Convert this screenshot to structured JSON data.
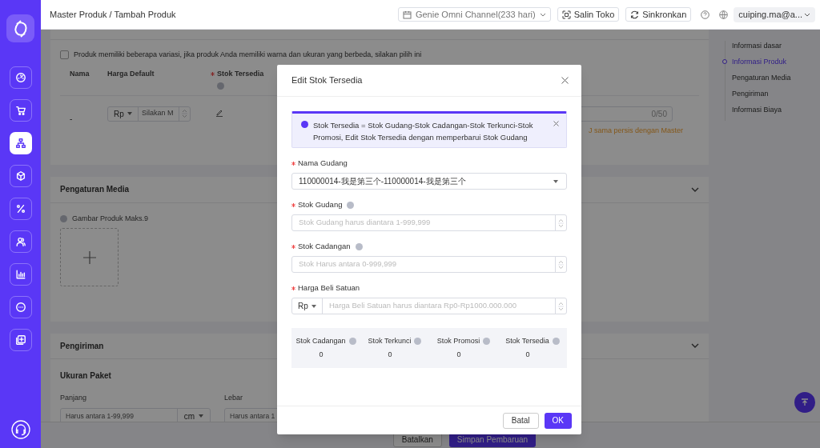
{
  "sidebar": {
    "items": [
      {
        "selected": false
      },
      {
        "selected": false
      },
      {
        "selected": true
      },
      {
        "selected": false
      },
      {
        "selected": false
      },
      {
        "selected": false
      },
      {
        "selected": false
      },
      {
        "selected": false
      },
      {
        "selected": false
      }
    ]
  },
  "header": {
    "breadcrumb": "Master Produk / Tambah Produk",
    "store_select": "Genie Omni Channel(233 hari)",
    "buttons": [
      "Salin Toko",
      "Sinkronkan"
    ],
    "user": "cuiping.ma@a..."
  },
  "variants": {
    "checkbox": {
      "label": "Produk memiliki beberapa variasi, jika produk Anda memiliki warna dan ukuran yang berbeda, silakan pilih ini",
      "checked": false
    },
    "columns": [
      {
        "label": "Nama",
        "required": false,
        "info": false
      },
      {
        "label": "Harga Default",
        "required": false,
        "info": false
      },
      {
        "label": "Stok Tersedia",
        "required": true,
        "info": true
      }
    ],
    "row": {
      "name": "-",
      "currency": "Rp",
      "price_placeholder": "Silakan M",
      "counter": "0/50",
      "warning": "J sama persis dengan Master"
    }
  },
  "media": {
    "title": "Pengaturan Media",
    "note": "Gambar Produk Maks.9"
  },
  "shipping": {
    "title": "Pengiriman",
    "subtitle": "Ukuran Paket",
    "fields": [
      {
        "label": "Panjang",
        "placeholder": "Harus antara 1-99,999",
        "unit": "cm"
      },
      {
        "label": "Lebar",
        "placeholder": "Harus antara 1"
      }
    ]
  },
  "footer_buttons": [
    "Batalkan",
    "Simpan Pembaruan"
  ],
  "anchor_nav": [
    {
      "label": "Informasi dasar",
      "selected": false
    },
    {
      "label": "Informasi Produk",
      "selected": true
    },
    {
      "label": "Pengaturan Media",
      "selected": false
    },
    {
      "label": "Pengiriman",
      "selected": false
    },
    {
      "label": "Informasi Biaya",
      "selected": false
    }
  ],
  "modal": {
    "title": "Edit Stok Tersedia",
    "alert": "Stok Tersedia = Stok Gudang-Stok Cadangan-Stok Terkunci-Stok Promosi, Edit Stok Tersedia dengan memperbarui Stok Gudang",
    "fields": [
      {
        "kind": "select",
        "label": "Nama Gudang",
        "required": true,
        "info": false,
        "value": "110000014-我是第三个-110000014-我是第三个"
      },
      {
        "kind": "number",
        "label": "Stok Gudang",
        "required": true,
        "info": true,
        "placeholder": "Stok Gudang harus diantara 1-999,999"
      },
      {
        "kind": "number",
        "label": "Stok Cadangan",
        "required": true,
        "info": true,
        "placeholder": "Stok Harus antara 0-999,999"
      },
      {
        "kind": "currency",
        "label": "Harga Beli Satuan",
        "required": true,
        "info": false,
        "currency": "Rp",
        "placeholder": "Harga Beli Satuan harus diantara Rp0-Rp1000.000.000"
      }
    ],
    "summary": [
      {
        "label": "Stok Cadangan",
        "value": "0"
      },
      {
        "label": "Stok Terkunci",
        "value": "0"
      },
      {
        "label": "Stok Promosi",
        "value": "0"
      },
      {
        "label": "Stok Tersedia",
        "value": "0"
      }
    ],
    "buttons": [
      {
        "label": "Batal",
        "kind": "secondary"
      },
      {
        "label": "OK",
        "kind": "primary"
      }
    ]
  }
}
